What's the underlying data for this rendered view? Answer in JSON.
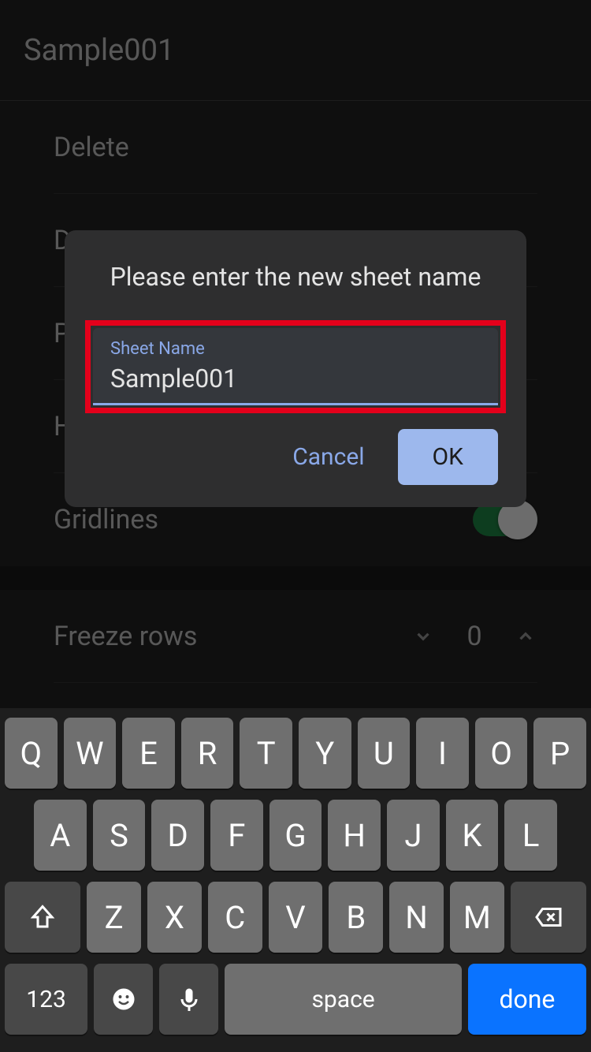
{
  "header": {
    "title": "Sample001"
  },
  "menu": {
    "delete": "Delete",
    "partial_d": "D",
    "partial_p": "P",
    "partial_h": "H",
    "gridlines": "Gridlines",
    "freeze_rows": "Freeze rows",
    "freeze_rows_value": "0"
  },
  "dialog": {
    "title": "Please enter the new sheet name",
    "field_label": "Sheet Name",
    "field_value": "Sample001",
    "cancel": "Cancel",
    "ok": "OK"
  },
  "keyboard": {
    "row1": [
      "Q",
      "W",
      "E",
      "R",
      "T",
      "Y",
      "U",
      "I",
      "O",
      "P"
    ],
    "row2": [
      "A",
      "S",
      "D",
      "F",
      "G",
      "H",
      "J",
      "K",
      "L"
    ],
    "row3": [
      "Z",
      "X",
      "C",
      "V",
      "B",
      "N",
      "M"
    ],
    "key_123": "123",
    "key_space": "space",
    "key_done": "done"
  }
}
